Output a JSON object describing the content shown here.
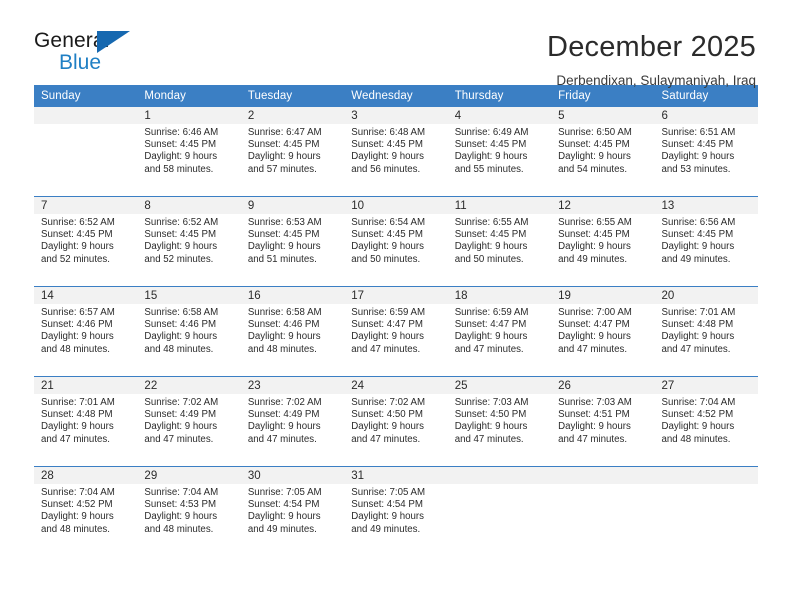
{
  "brand": {
    "name_part1": "General",
    "name_part2": "Blue",
    "triangle_icon": "triangle-logo-icon",
    "accent_color": "#1668b0",
    "blue_text_color": "#1f7fc4"
  },
  "header": {
    "title": "December 2025",
    "subtitle": "Derbendixan, Sulaymaniyah, Iraq"
  },
  "calendar": {
    "header_bg": "#3b7fc4",
    "daynum_band_bg": "#f2f2f2",
    "weekdays": [
      "Sunday",
      "Monday",
      "Tuesday",
      "Wednesday",
      "Thursday",
      "Friday",
      "Saturday"
    ],
    "weeks": [
      [
        {
          "day": "",
          "lines": []
        },
        {
          "day": "1",
          "lines": [
            "Sunrise: 6:46 AM",
            "Sunset: 4:45 PM",
            "Daylight: 9 hours",
            "and 58 minutes."
          ]
        },
        {
          "day": "2",
          "lines": [
            "Sunrise: 6:47 AM",
            "Sunset: 4:45 PM",
            "Daylight: 9 hours",
            "and 57 minutes."
          ]
        },
        {
          "day": "3",
          "lines": [
            "Sunrise: 6:48 AM",
            "Sunset: 4:45 PM",
            "Daylight: 9 hours",
            "and 56 minutes."
          ]
        },
        {
          "day": "4",
          "lines": [
            "Sunrise: 6:49 AM",
            "Sunset: 4:45 PM",
            "Daylight: 9 hours",
            "and 55 minutes."
          ]
        },
        {
          "day": "5",
          "lines": [
            "Sunrise: 6:50 AM",
            "Sunset: 4:45 PM",
            "Daylight: 9 hours",
            "and 54 minutes."
          ]
        },
        {
          "day": "6",
          "lines": [
            "Sunrise: 6:51 AM",
            "Sunset: 4:45 PM",
            "Daylight: 9 hours",
            "and 53 minutes."
          ]
        }
      ],
      [
        {
          "day": "7",
          "lines": [
            "Sunrise: 6:52 AM",
            "Sunset: 4:45 PM",
            "Daylight: 9 hours",
            "and 52 minutes."
          ]
        },
        {
          "day": "8",
          "lines": [
            "Sunrise: 6:52 AM",
            "Sunset: 4:45 PM",
            "Daylight: 9 hours",
            "and 52 minutes."
          ]
        },
        {
          "day": "9",
          "lines": [
            "Sunrise: 6:53 AM",
            "Sunset: 4:45 PM",
            "Daylight: 9 hours",
            "and 51 minutes."
          ]
        },
        {
          "day": "10",
          "lines": [
            "Sunrise: 6:54 AM",
            "Sunset: 4:45 PM",
            "Daylight: 9 hours",
            "and 50 minutes."
          ]
        },
        {
          "day": "11",
          "lines": [
            "Sunrise: 6:55 AM",
            "Sunset: 4:45 PM",
            "Daylight: 9 hours",
            "and 50 minutes."
          ]
        },
        {
          "day": "12",
          "lines": [
            "Sunrise: 6:55 AM",
            "Sunset: 4:45 PM",
            "Daylight: 9 hours",
            "and 49 minutes."
          ]
        },
        {
          "day": "13",
          "lines": [
            "Sunrise: 6:56 AM",
            "Sunset: 4:45 PM",
            "Daylight: 9 hours",
            "and 49 minutes."
          ]
        }
      ],
      [
        {
          "day": "14",
          "lines": [
            "Sunrise: 6:57 AM",
            "Sunset: 4:46 PM",
            "Daylight: 9 hours",
            "and 48 minutes."
          ]
        },
        {
          "day": "15",
          "lines": [
            "Sunrise: 6:58 AM",
            "Sunset: 4:46 PM",
            "Daylight: 9 hours",
            "and 48 minutes."
          ]
        },
        {
          "day": "16",
          "lines": [
            "Sunrise: 6:58 AM",
            "Sunset: 4:46 PM",
            "Daylight: 9 hours",
            "and 48 minutes."
          ]
        },
        {
          "day": "17",
          "lines": [
            "Sunrise: 6:59 AM",
            "Sunset: 4:47 PM",
            "Daylight: 9 hours",
            "and 47 minutes."
          ]
        },
        {
          "day": "18",
          "lines": [
            "Sunrise: 6:59 AM",
            "Sunset: 4:47 PM",
            "Daylight: 9 hours",
            "and 47 minutes."
          ]
        },
        {
          "day": "19",
          "lines": [
            "Sunrise: 7:00 AM",
            "Sunset: 4:47 PM",
            "Daylight: 9 hours",
            "and 47 minutes."
          ]
        },
        {
          "day": "20",
          "lines": [
            "Sunrise: 7:01 AM",
            "Sunset: 4:48 PM",
            "Daylight: 9 hours",
            "and 47 minutes."
          ]
        }
      ],
      [
        {
          "day": "21",
          "lines": [
            "Sunrise: 7:01 AM",
            "Sunset: 4:48 PM",
            "Daylight: 9 hours",
            "and 47 minutes."
          ]
        },
        {
          "day": "22",
          "lines": [
            "Sunrise: 7:02 AM",
            "Sunset: 4:49 PM",
            "Daylight: 9 hours",
            "and 47 minutes."
          ]
        },
        {
          "day": "23",
          "lines": [
            "Sunrise: 7:02 AM",
            "Sunset: 4:49 PM",
            "Daylight: 9 hours",
            "and 47 minutes."
          ]
        },
        {
          "day": "24",
          "lines": [
            "Sunrise: 7:02 AM",
            "Sunset: 4:50 PM",
            "Daylight: 9 hours",
            "and 47 minutes."
          ]
        },
        {
          "day": "25",
          "lines": [
            "Sunrise: 7:03 AM",
            "Sunset: 4:50 PM",
            "Daylight: 9 hours",
            "and 47 minutes."
          ]
        },
        {
          "day": "26",
          "lines": [
            "Sunrise: 7:03 AM",
            "Sunset: 4:51 PM",
            "Daylight: 9 hours",
            "and 47 minutes."
          ]
        },
        {
          "day": "27",
          "lines": [
            "Sunrise: 7:04 AM",
            "Sunset: 4:52 PM",
            "Daylight: 9 hours",
            "and 48 minutes."
          ]
        }
      ],
      [
        {
          "day": "28",
          "lines": [
            "Sunrise: 7:04 AM",
            "Sunset: 4:52 PM",
            "Daylight: 9 hours",
            "and 48 minutes."
          ]
        },
        {
          "day": "29",
          "lines": [
            "Sunrise: 7:04 AM",
            "Sunset: 4:53 PM",
            "Daylight: 9 hours",
            "and 48 minutes."
          ]
        },
        {
          "day": "30",
          "lines": [
            "Sunrise: 7:05 AM",
            "Sunset: 4:54 PM",
            "Daylight: 9 hours",
            "and 49 minutes."
          ]
        },
        {
          "day": "31",
          "lines": [
            "Sunrise: 7:05 AM",
            "Sunset: 4:54 PM",
            "Daylight: 9 hours",
            "and 49 minutes."
          ]
        },
        {
          "day": "",
          "lines": []
        },
        {
          "day": "",
          "lines": []
        },
        {
          "day": "",
          "lines": []
        }
      ]
    ]
  }
}
